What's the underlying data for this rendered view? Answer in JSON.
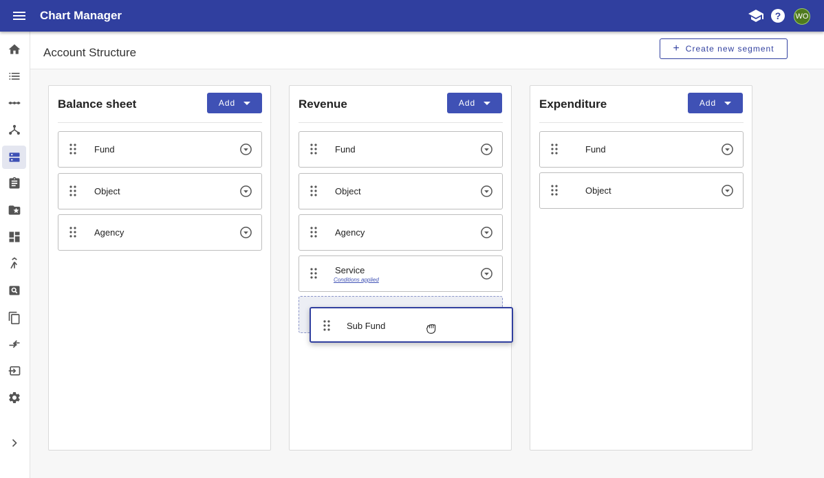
{
  "app": {
    "title": "Chart Manager",
    "avatar_initials": "WO",
    "brand_color": "#303f9f"
  },
  "header_icons": [
    "menu-icon",
    "school-icon",
    "help-icon"
  ],
  "sidebar": {
    "items": [
      {
        "name": "home-icon"
      },
      {
        "name": "list-icon"
      },
      {
        "name": "dots-line-icon"
      },
      {
        "name": "hierarchy-icon"
      },
      {
        "name": "segments-icon",
        "active": true
      },
      {
        "name": "clipboard-icon"
      },
      {
        "name": "folder-star-icon"
      },
      {
        "name": "dashboard-icon"
      },
      {
        "name": "merge-icon"
      },
      {
        "name": "image-search-icon"
      },
      {
        "name": "copy-icon"
      },
      {
        "name": "swap-icon"
      },
      {
        "name": "import-icon"
      },
      {
        "name": "settings-icon"
      }
    ],
    "expand_icon": "chevron-right-icon"
  },
  "page": {
    "title": "Account Structure",
    "create_label": "Create new segment"
  },
  "columns": [
    {
      "title": "Balance sheet",
      "add_label": "Add",
      "segments": [
        {
          "label": "Fund"
        },
        {
          "label": "Object"
        },
        {
          "label": "Agency"
        }
      ]
    },
    {
      "title": "Revenue",
      "add_label": "Add",
      "segments": [
        {
          "label": "Fund"
        },
        {
          "label": "Object"
        },
        {
          "label": "Agency"
        },
        {
          "label": "Service",
          "note": "Conditions applied"
        }
      ]
    },
    {
      "title": "Expenditure",
      "add_label": "Add",
      "segments": [
        {
          "label": "Fund"
        },
        {
          "label": "Object"
        }
      ]
    }
  ],
  "dragging": {
    "label": "Sub Fund"
  }
}
